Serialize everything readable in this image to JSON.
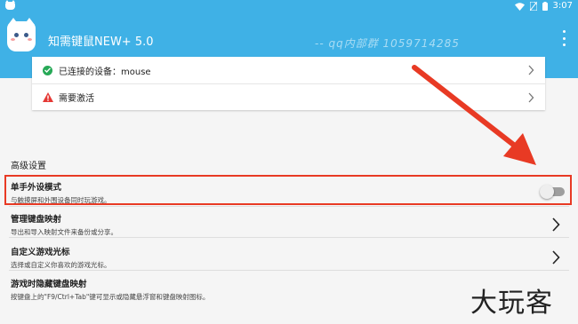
{
  "status_bar": {
    "time": "3:07",
    "icons": [
      "cat-icon",
      "wifi-icon",
      "no-sim-icon",
      "battery-icon"
    ]
  },
  "app_bar": {
    "title": "知需键鼠NEW+ 5.0",
    "watermark": "-- qq内部群 1059714285",
    "menu_icon": "more-vert-icon",
    "color": "#3fb1e6"
  },
  "status_card": {
    "connected_label": "已连接的设备：mouse",
    "activate_label": "需要激活"
  },
  "advanced": {
    "section_title": "高级设置",
    "items": [
      {
        "title": "单手外设模式",
        "subtitle": "与触摸屏和外围设备同时玩游戏。",
        "control": "toggle",
        "enabled": false
      },
      {
        "title": "管理键盘映射",
        "subtitle": "导出和导入映射文件来备份或分享。",
        "control": "chevron"
      },
      {
        "title": "自定义游戏光标",
        "subtitle": "选择或自定义你喜欢的游戏光标。",
        "control": "chevron"
      },
      {
        "title": "游戏时隐藏键盘映射",
        "subtitle": "按键盘上的\"F9/Ctrl+Tab\"键可显示或隐藏悬浮窗和键盘映射图标。",
        "control": "none"
      }
    ]
  },
  "overlay": {
    "highlight_color": "#e83a24",
    "arrow_color": "#e83a24",
    "brand_text": "大玩客"
  }
}
